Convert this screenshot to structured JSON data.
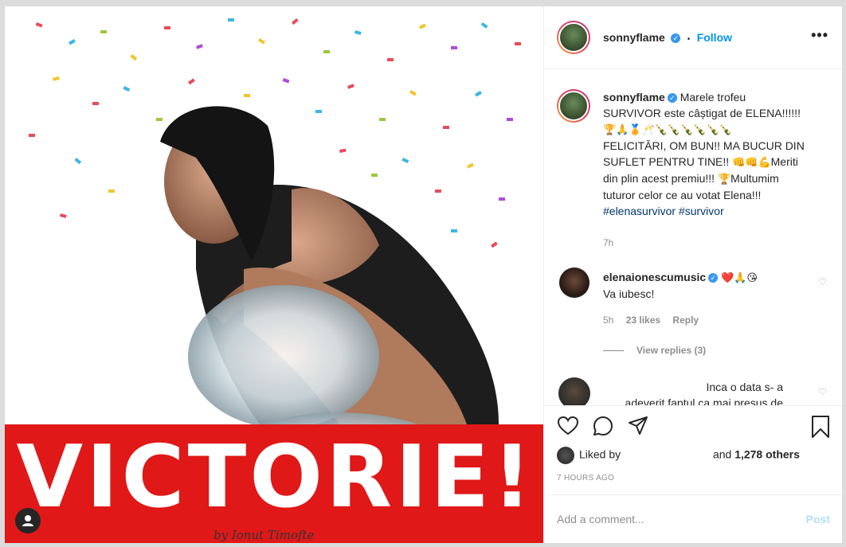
{
  "post": {
    "author": "sonnyflame",
    "follow_label": "Follow",
    "more_icon": "more-dots-icon",
    "image": {
      "banner_text": "VICTORIE!",
      "signature": "by Ionut Timofte"
    },
    "caption": {
      "user": "sonnyflame",
      "line1": "Marele trofeu",
      "line2": "SURVIVOR este câștigat de ELENA!!!!!!",
      "emoji_line1": "🏆🙏🏅🥂🍾🍾🍾🍾🍾🍾",
      "line3": "FELICITĂRI, OM BUN!! MA BUCUR DIN",
      "line4": "SUFLET PENTRU TINE!! ",
      "emoji_line2": "👊👊💪",
      "line4b": "Meriti",
      "line5": "din plin acest premiu!!! ",
      "emoji_line3": "🏆",
      "line5b": "Multumim",
      "line6": "tuturor celor ce au votat Elena!!!",
      "hashtags": "#elenasurvivor #survivor",
      "time": "7h"
    },
    "comments": [
      {
        "user": "elenaionescumusic",
        "emojis": "❤️🙏😘",
        "text": "Va iubesc!",
        "time": "5h",
        "likes": "23 likes",
        "reply": "Reply",
        "view_replies": "View replies (3)"
      },
      {
        "user": "",
        "text_line1": "Inca o data s- a",
        "text_line2": "adeverit faptul ca mai presus de"
      }
    ],
    "likes": {
      "prefix": "Liked by",
      "middle": "and",
      "count": "1,278 others"
    },
    "time_ago": "7 HOURS AGO",
    "add_comment_placeholder": "Add a comment...",
    "post_label": "Post"
  },
  "colors": {
    "banner_red": "#e01818",
    "link_blue": "#0095f6",
    "hashtag": "#00376b",
    "muted": "#8e8e8e"
  }
}
